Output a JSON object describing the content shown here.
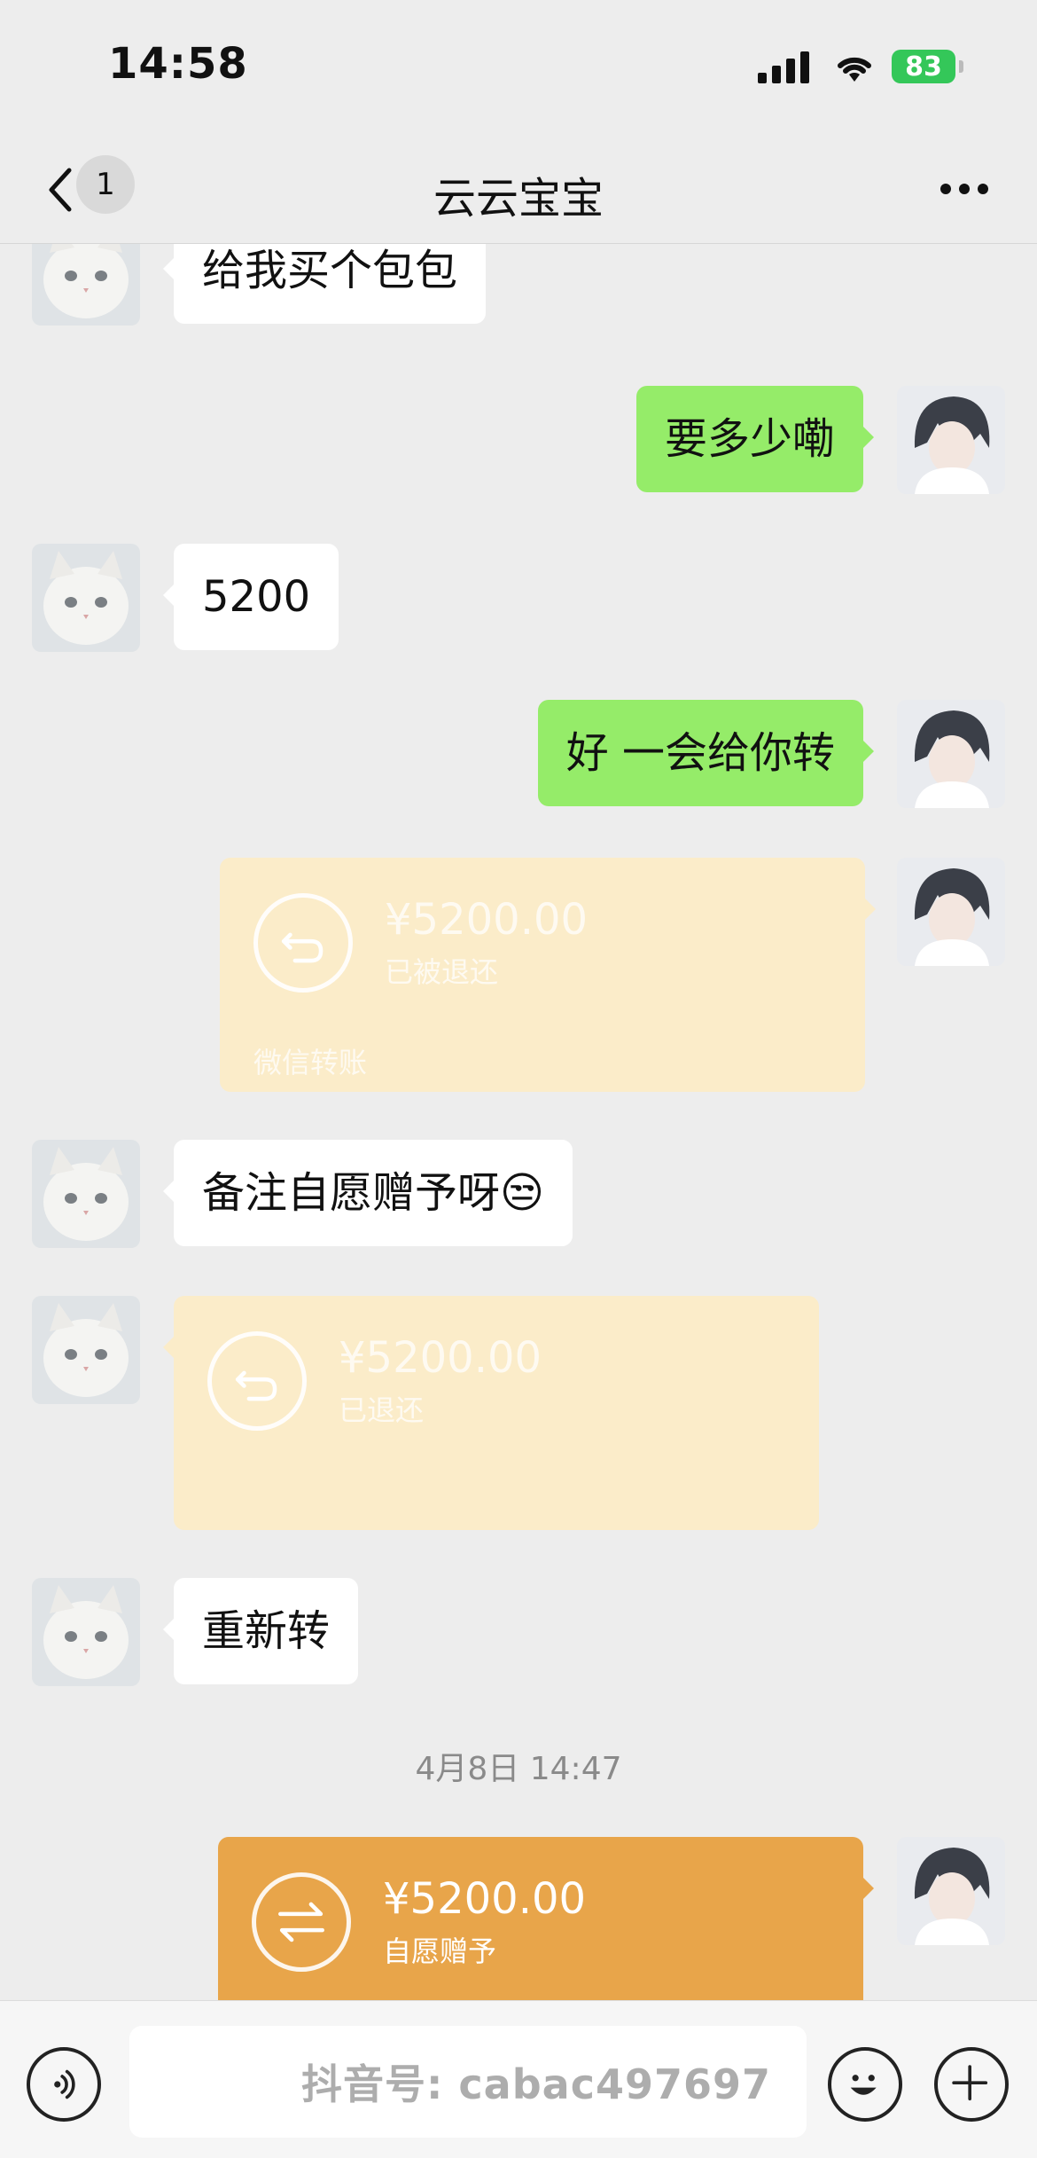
{
  "status_bar": {
    "time": "14:58",
    "battery": "83"
  },
  "header": {
    "back_count": "1",
    "title": "云云宝宝"
  },
  "messages": [
    {
      "type": "text",
      "side": "in",
      "text": "给我买个包包"
    },
    {
      "type": "text",
      "side": "out",
      "text": "要多少嘞"
    },
    {
      "type": "text",
      "side": "in",
      "text": "5200"
    },
    {
      "type": "text",
      "side": "out",
      "text": "好 一会给你转"
    },
    {
      "type": "transfer",
      "side": "out",
      "amount": "¥5200.00",
      "status": "已被退还",
      "footer": "微信转账"
    },
    {
      "type": "text",
      "side": "in",
      "text": "备注自愿赠予呀😒"
    },
    {
      "type": "transfer",
      "side": "in",
      "amount": "¥5200.00",
      "status": "已退还",
      "footer": ""
    },
    {
      "type": "text",
      "side": "in",
      "text": "重新转"
    },
    {
      "type": "timestamp",
      "text": "4月8日 14:47"
    },
    {
      "type": "transfer",
      "side": "out",
      "amount": "¥5200.00",
      "status": "自愿赠予",
      "footer": ""
    }
  ],
  "watermark": "抖音号: cabac497697",
  "colors": {
    "outgoing_bubble": "#95ec69",
    "transfer_active": "#e8a54a",
    "transfer_faded": "#fbecc9"
  },
  "icons": [
    "back-chevron-icon",
    "more-icon",
    "transfer-return-icon",
    "transfer-exchange-icon",
    "voice-icon",
    "emoji-icon",
    "plus-icon"
  ]
}
